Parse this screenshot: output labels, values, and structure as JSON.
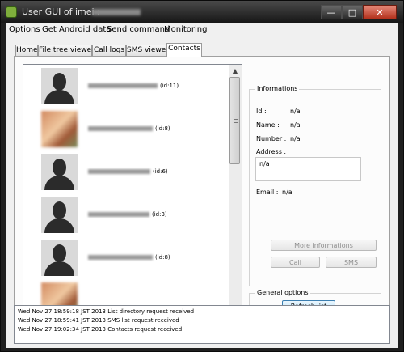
{
  "window": {
    "title_prefix": "User GUI of imei :"
  },
  "menu": [
    "Options",
    "Get Android data",
    "Send command",
    "Monitoring"
  ],
  "tabs": [
    "Home",
    "File tree viewer",
    "Call logs",
    "SMS viewer",
    "Contacts"
  ],
  "active_tab": "Contacts",
  "contacts": [
    {
      "id_label": "(id:11)",
      "avatar": "silhouette-icon"
    },
    {
      "id_label": "(id:8)",
      "avatar": "photo"
    },
    {
      "id_label": "(id:6)",
      "avatar": "silhouette-icon"
    },
    {
      "id_label": "(id:3)",
      "avatar": "silhouette-icon"
    },
    {
      "id_label": "(id:8)",
      "avatar": "silhouette-icon"
    }
  ],
  "informations": {
    "title": "Informations",
    "id_label": "Id :",
    "id_value": "n/a",
    "name_label": "Name :",
    "name_value": "n/a",
    "number_label": "Number :",
    "number_value": "n/a",
    "address_label": "Address :",
    "address_value": "n/a",
    "email_label": "Email :",
    "email_value": "n/a",
    "more_button": "More informations",
    "call_button": "Call",
    "sms_button": "SMS"
  },
  "general_options": {
    "title": "General options",
    "refresh_button": "Refresh list"
  },
  "log": [
    "Wed Nov 27 18:59:18 JST 2013 List directory request received",
    "Wed Nov 27 18:59:41 JST 2013 SMS list request received",
    "Wed Nov 27 19:02:34 JST 2013 Contacts request received"
  ],
  "window_buttons": {
    "minimize": "—",
    "maximize": "□",
    "close": "✕"
  }
}
